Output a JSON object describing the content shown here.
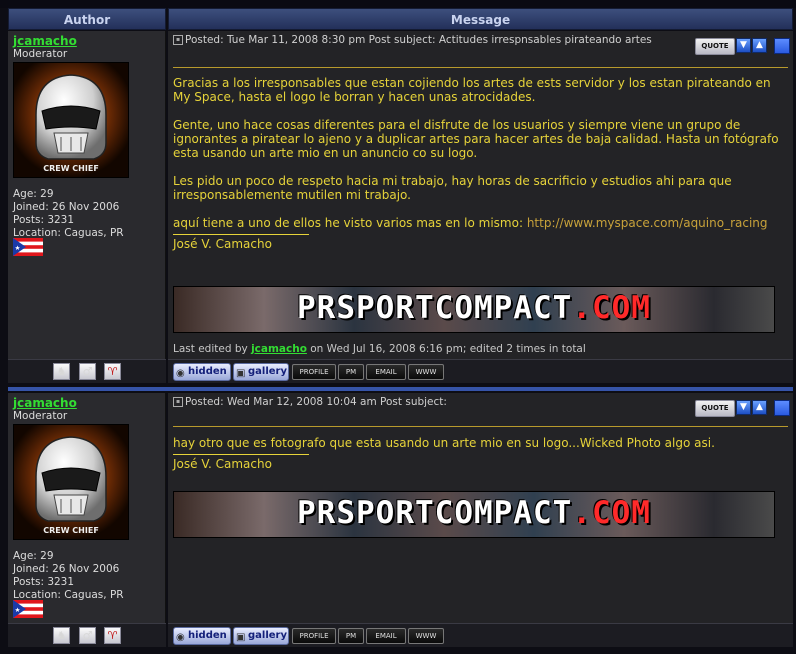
{
  "headers": {
    "author": "Author",
    "message": "Message"
  },
  "posts": [
    {
      "author": {
        "name": "jcamacho",
        "rank": "Moderator",
        "avatar_text": "CREW CHIEF",
        "age": "Age: 29",
        "joined": "Joined: 26 Nov 2006",
        "posts": "Posts: 3231",
        "location": "Location: Caguas, PR"
      },
      "meta": "Posted: Tue Mar 11, 2008 8:30 pm   Post subject:  Actitudes irrespnsables pirateando artes",
      "body": [
        "Gracias a los irresponsables que estan cojiendo los artes de ests servidor y los estan pirateando en My Space, hasta el logo le borran y hacen unas atrocidades.",
        "Gente, uno hace cosas diferentes para el disfrute de los usuarios y siempre viene un grupo de ignorantes a piratear lo ajeno y a duplicar artes para hacer artes de baja calidad. Hasta un fotógrafo esta usando un arte mio en un anuncio co su logo.",
        "Les pido un poco de respeto hacia mi trabajo, hay horas de sacrificio y estudios ahi para que irresponsablemente mutilen mi trabajo."
      ],
      "link_prefix": "aquí tiene a uno de ellos he visto varios mas en lo mismo: ",
      "link_text": "http://www.myspace.com/aquino_racing",
      "signature": "José V. Camacho",
      "banner_main": "PRSPORTCOMPACT",
      "banner_ext": ".COM",
      "edited_prefix": "Last edited by ",
      "edited_user": "jcamacho",
      "edited_suffix": " on Wed Jul 16, 2008 6:16 pm; edited 2 times in total"
    },
    {
      "author": {
        "name": "jcamacho",
        "rank": "Moderator",
        "avatar_text": "CREW CHIEF",
        "age": "Age: 29",
        "joined": "Joined: 26 Nov 2006",
        "posts": "Posts: 3231",
        "location": "Location: Caguas, PR"
      },
      "meta": "Posted: Wed Mar 12, 2008 10:04 am   Post subject:",
      "body": [
        "hay otro que es fotografo que esta usando un arte mio en su logo...Wicked Photo algo asi."
      ],
      "signature": "José V. Camacho",
      "banner_main": "PRSPORTCOMPACT",
      "banner_ext": ".COM"
    }
  ],
  "buttons": {
    "quote": "QUOTE",
    "hidden": "hidden",
    "gallery": "gallery",
    "profile": "PROFILE",
    "pm": "PM",
    "email": "EMAIL",
    "www": "WWW"
  },
  "icons": {
    "up": "▲",
    "down": "▼"
  }
}
